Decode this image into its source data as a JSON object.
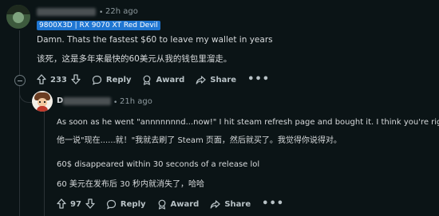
{
  "comment_1": {
    "timestamp": "22h ago",
    "flair": "9800X3D | RX 9070 XT Red Devil",
    "body_en": "Damn. Thats the fastest $60 to leave my wallet in years",
    "body_zh": "该死，这是多年来最快的60美元从我的钱包里溜走。",
    "votes": "233",
    "actions": {
      "reply": "Reply",
      "award": "Award",
      "share": "Share",
      "more": "•••"
    }
  },
  "comment_2": {
    "username_initial": "D",
    "timestamp": "21h ago",
    "body_en_1": "As soon as he went \"annnnnnnd...now!\" I hit steam refresh page and bought it. I think you're right.",
    "body_zh_1": "他一说\"现在......就！\"我就去刷了 Steam 页面，然后就买了。我觉得你说得对。",
    "body_en_2": "60$ disappeared within 30 seconds of a release lol",
    "body_zh_2": "60 美元在发布后 30 秒内就消失了，哈哈",
    "votes": "97",
    "actions": {
      "reply": "Reply",
      "award": "Award",
      "share": "Share",
      "more": "•••"
    }
  },
  "separator": "•",
  "icons": {
    "upvote": "arrow-up-icon",
    "downvote": "arrow-down-icon",
    "reply": "speech-bubble-icon",
    "award": "award-ribbon-icon",
    "share": "share-arrow-icon",
    "collapse": "collapse-minus-icon"
  },
  "colors": {
    "background": "#0b1416",
    "flair_bg": "#1f76d2",
    "text": "#d7dadc",
    "muted": "#8e9a9f"
  }
}
